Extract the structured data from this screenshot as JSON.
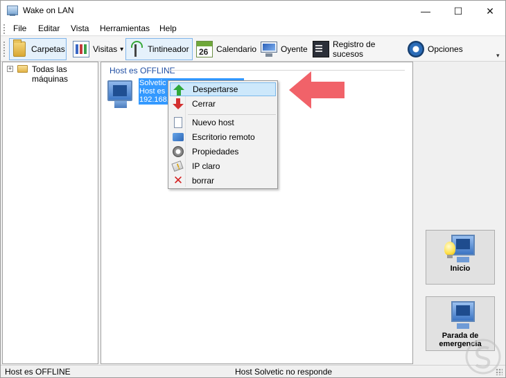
{
  "window": {
    "title": "Wake on LAN"
  },
  "window_controls": {
    "minimize": "—",
    "maximize": "☐",
    "close": "✕"
  },
  "menubar": {
    "items": [
      "File",
      "Editar",
      "Vista",
      "Herramientas",
      "Help"
    ]
  },
  "toolbar": {
    "carpetas": "Carpetas",
    "visitas": "Visitas",
    "visitas_dropdown": "▾",
    "tintineador": "Tintineador",
    "calendario": "Calendario",
    "calendario_icon_text": "26",
    "oyente": "Oyente",
    "registro": "Registro de sucesos",
    "opciones": "Opciones",
    "overflow": "▾"
  },
  "tree": {
    "expander": "+",
    "root_label": "Todas las máquinas"
  },
  "main": {
    "group_title": "Host es OFFLINE",
    "host_label_lines": [
      "Solvetic",
      "Host es O",
      "192.168."
    ]
  },
  "context_menu": {
    "items": [
      {
        "label": "Despertarse",
        "icon": "green-up-arrow-icon",
        "highlighted": true
      },
      {
        "label": "Cerrar",
        "icon": "red-down-arrow-icon"
      },
      {
        "label": "Nuevo host",
        "icon": "document-icon"
      },
      {
        "label": "Escritorio remoto",
        "icon": "remote-desktop-icon"
      },
      {
        "label": "Propiedades",
        "icon": "gear-icon"
      },
      {
        "label": "IP claro",
        "icon": "eraser-icon"
      },
      {
        "label": "borrar",
        "icon": "red-x-icon"
      }
    ]
  },
  "side_buttons": {
    "inicio": "Inicio",
    "parada_lines": [
      "Parada de",
      "emergencia"
    ]
  },
  "statusbar": {
    "left": "Host es OFFLINE",
    "center": "Host Solvetic no responde"
  },
  "colors": {
    "selection": "#3399ff",
    "menu_highlight": "#cde8fb",
    "group_title": "#1f4ea3",
    "callout_arrow": "#f0555c"
  }
}
